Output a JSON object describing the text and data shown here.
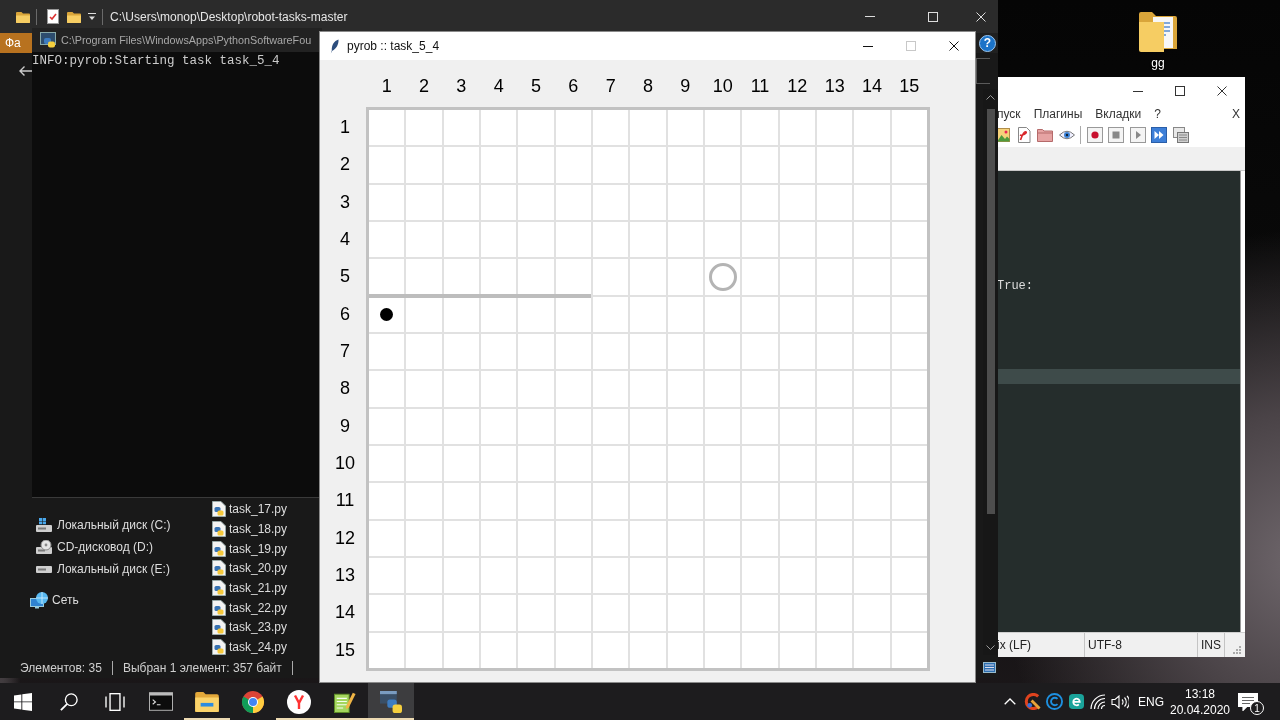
{
  "desktop_icons": [
    {
      "label": "gg"
    }
  ],
  "explorer": {
    "title": "C:\\Users\\monop\\Desktop\\robot-tasks-master",
    "ribbon_tab": "Фа",
    "help": "?",
    "nav_items": [
      {
        "kind": "system",
        "label": "Локальный диск (C:)"
      },
      {
        "kind": "optical",
        "label": "CD-дисковод (D:)"
      },
      {
        "kind": "drive",
        "label": "Локальный диск (E:)"
      },
      {
        "kind": "network",
        "label": "Сеть"
      }
    ],
    "files": [
      {
        "name": "task_17.py"
      },
      {
        "name": "task_18.py"
      },
      {
        "name": "task_19.py"
      },
      {
        "name": "task_20.py"
      },
      {
        "name": "task_21.py"
      },
      {
        "name": "task_22.py"
      },
      {
        "name": "task_23.py"
      },
      {
        "name": "task_24.py"
      }
    ],
    "status": [
      "Элементов: 35",
      "Выбран 1 элемент: 357 байт"
    ]
  },
  "console": {
    "title": "C:\\Program Files\\WindowsApps\\PythonSoftwareFou",
    "lines": [
      "INFO:pyrob:Starting task task_5_4"
    ]
  },
  "pyrob": {
    "title": "pyrob :: task_5_4",
    "controls": [
      {
        "kind": "minimize",
        "disabled": false
      },
      {
        "kind": "maximize",
        "disabled": true
      },
      {
        "kind": "close",
        "disabled": false
      }
    ],
    "columns": [
      "1",
      "2",
      "3",
      "4",
      "5",
      "6",
      "7",
      "8",
      "9",
      "10",
      "11",
      "12",
      "13",
      "14",
      "15"
    ],
    "rows": [
      {
        "label": "1",
        "cells": [
          {
            "kind": "floor"
          },
          {
            "kind": "floor"
          },
          {
            "kind": "floor"
          },
          {
            "kind": "floor"
          },
          {
            "kind": "floor"
          },
          {
            "kind": "floor"
          },
          {
            "kind": "floor"
          },
          {
            "kind": "floor"
          },
          {
            "kind": "floor"
          },
          {
            "kind": "floor"
          },
          {
            "kind": "floor"
          },
          {
            "kind": "floor"
          },
          {
            "kind": "floor"
          },
          {
            "kind": "floor"
          },
          {
            "kind": "floor"
          }
        ]
      },
      {
        "label": "2",
        "cells": [
          {
            "kind": "floor"
          },
          {
            "kind": "floor"
          },
          {
            "kind": "floor"
          },
          {
            "kind": "floor"
          },
          {
            "kind": "floor"
          },
          {
            "kind": "floor"
          },
          {
            "kind": "floor"
          },
          {
            "kind": "floor"
          },
          {
            "kind": "floor"
          },
          {
            "kind": "floor"
          },
          {
            "kind": "floor"
          },
          {
            "kind": "floor"
          },
          {
            "kind": "floor"
          },
          {
            "kind": "floor"
          },
          {
            "kind": "floor"
          }
        ]
      },
      {
        "label": "3",
        "cells": [
          {
            "kind": "floor"
          },
          {
            "kind": "floor"
          },
          {
            "kind": "floor"
          },
          {
            "kind": "floor"
          },
          {
            "kind": "floor"
          },
          {
            "kind": "floor"
          },
          {
            "kind": "floor"
          },
          {
            "kind": "floor"
          },
          {
            "kind": "floor"
          },
          {
            "kind": "floor"
          },
          {
            "kind": "floor"
          },
          {
            "kind": "floor"
          },
          {
            "kind": "floor"
          },
          {
            "kind": "floor"
          },
          {
            "kind": "floor"
          }
        ]
      },
      {
        "label": "4",
        "cells": [
          {
            "kind": "floor"
          },
          {
            "kind": "floor"
          },
          {
            "kind": "floor"
          },
          {
            "kind": "floor"
          },
          {
            "kind": "floor"
          },
          {
            "kind": "floor"
          },
          {
            "kind": "floor"
          },
          {
            "kind": "floor"
          },
          {
            "kind": "floor"
          },
          {
            "kind": "floor"
          },
          {
            "kind": "floor"
          },
          {
            "kind": "floor"
          },
          {
            "kind": "floor"
          },
          {
            "kind": "floor"
          },
          {
            "kind": "floor"
          }
        ]
      },
      {
        "label": "5",
        "cells": [
          {
            "kind": "wall"
          },
          {
            "kind": "wall"
          },
          {
            "kind": "wall"
          },
          {
            "kind": "wall"
          },
          {
            "kind": "wall"
          },
          {
            "kind": "wall"
          },
          {
            "kind": "floor"
          },
          {
            "kind": "floor"
          },
          {
            "kind": "floor"
          },
          {
            "kind": "target"
          },
          {
            "kind": "floor"
          },
          {
            "kind": "floor"
          },
          {
            "kind": "floor"
          },
          {
            "kind": "floor"
          },
          {
            "kind": "floor"
          }
        ]
      },
      {
        "label": "6",
        "cells": [
          {
            "kind": "robot"
          },
          {
            "kind": "floor"
          },
          {
            "kind": "floor"
          },
          {
            "kind": "floor"
          },
          {
            "kind": "floor"
          },
          {
            "kind": "floor"
          },
          {
            "kind": "floor"
          },
          {
            "kind": "floor"
          },
          {
            "kind": "floor"
          },
          {
            "kind": "floor"
          },
          {
            "kind": "floor"
          },
          {
            "kind": "floor"
          },
          {
            "kind": "floor"
          },
          {
            "kind": "floor"
          },
          {
            "kind": "floor"
          }
        ]
      },
      {
        "label": "7",
        "cells": [
          {
            "kind": "floor"
          },
          {
            "kind": "floor"
          },
          {
            "kind": "floor"
          },
          {
            "kind": "floor"
          },
          {
            "kind": "floor"
          },
          {
            "kind": "floor"
          },
          {
            "kind": "floor"
          },
          {
            "kind": "floor"
          },
          {
            "kind": "floor"
          },
          {
            "kind": "floor"
          },
          {
            "kind": "floor"
          },
          {
            "kind": "floor"
          },
          {
            "kind": "floor"
          },
          {
            "kind": "floor"
          },
          {
            "kind": "floor"
          }
        ]
      },
      {
        "label": "8",
        "cells": [
          {
            "kind": "floor"
          },
          {
            "kind": "floor"
          },
          {
            "kind": "floor"
          },
          {
            "kind": "floor"
          },
          {
            "kind": "floor"
          },
          {
            "kind": "floor"
          },
          {
            "kind": "floor"
          },
          {
            "kind": "floor"
          },
          {
            "kind": "floor"
          },
          {
            "kind": "floor"
          },
          {
            "kind": "floor"
          },
          {
            "kind": "floor"
          },
          {
            "kind": "floor"
          },
          {
            "kind": "floor"
          },
          {
            "kind": "floor"
          }
        ]
      },
      {
        "label": "9",
        "cells": [
          {
            "kind": "floor"
          },
          {
            "kind": "floor"
          },
          {
            "kind": "floor"
          },
          {
            "kind": "floor"
          },
          {
            "kind": "floor"
          },
          {
            "kind": "floor"
          },
          {
            "kind": "floor"
          },
          {
            "kind": "floor"
          },
          {
            "kind": "floor"
          },
          {
            "kind": "floor"
          },
          {
            "kind": "floor"
          },
          {
            "kind": "floor"
          },
          {
            "kind": "floor"
          },
          {
            "kind": "floor"
          },
          {
            "kind": "floor"
          }
        ]
      },
      {
        "label": "10",
        "cells": [
          {
            "kind": "floor"
          },
          {
            "kind": "floor"
          },
          {
            "kind": "floor"
          },
          {
            "kind": "floor"
          },
          {
            "kind": "floor"
          },
          {
            "kind": "floor"
          },
          {
            "kind": "floor"
          },
          {
            "kind": "floor"
          },
          {
            "kind": "floor"
          },
          {
            "kind": "floor"
          },
          {
            "kind": "floor"
          },
          {
            "kind": "floor"
          },
          {
            "kind": "floor"
          },
          {
            "kind": "floor"
          },
          {
            "kind": "floor"
          }
        ]
      },
      {
        "label": "11",
        "cells": [
          {
            "kind": "floor"
          },
          {
            "kind": "floor"
          },
          {
            "kind": "floor"
          },
          {
            "kind": "floor"
          },
          {
            "kind": "floor"
          },
          {
            "kind": "floor"
          },
          {
            "kind": "floor"
          },
          {
            "kind": "floor"
          },
          {
            "kind": "floor"
          },
          {
            "kind": "floor"
          },
          {
            "kind": "floor"
          },
          {
            "kind": "floor"
          },
          {
            "kind": "floor"
          },
          {
            "kind": "floor"
          },
          {
            "kind": "floor"
          }
        ]
      },
      {
        "label": "12",
        "cells": [
          {
            "kind": "floor"
          },
          {
            "kind": "floor"
          },
          {
            "kind": "floor"
          },
          {
            "kind": "floor"
          },
          {
            "kind": "floor"
          },
          {
            "kind": "floor"
          },
          {
            "kind": "floor"
          },
          {
            "kind": "floor"
          },
          {
            "kind": "floor"
          },
          {
            "kind": "floor"
          },
          {
            "kind": "floor"
          },
          {
            "kind": "floor"
          },
          {
            "kind": "floor"
          },
          {
            "kind": "floor"
          },
          {
            "kind": "floor"
          }
        ]
      },
      {
        "label": "13",
        "cells": [
          {
            "kind": "floor"
          },
          {
            "kind": "floor"
          },
          {
            "kind": "floor"
          },
          {
            "kind": "floor"
          },
          {
            "kind": "floor"
          },
          {
            "kind": "floor"
          },
          {
            "kind": "floor"
          },
          {
            "kind": "floor"
          },
          {
            "kind": "floor"
          },
          {
            "kind": "floor"
          },
          {
            "kind": "floor"
          },
          {
            "kind": "floor"
          },
          {
            "kind": "floor"
          },
          {
            "kind": "floor"
          },
          {
            "kind": "floor"
          }
        ]
      },
      {
        "label": "14",
        "cells": [
          {
            "kind": "floor"
          },
          {
            "kind": "floor"
          },
          {
            "kind": "floor"
          },
          {
            "kind": "floor"
          },
          {
            "kind": "floor"
          },
          {
            "kind": "floor"
          },
          {
            "kind": "floor"
          },
          {
            "kind": "floor"
          },
          {
            "kind": "floor"
          },
          {
            "kind": "floor"
          },
          {
            "kind": "floor"
          },
          {
            "kind": "floor"
          },
          {
            "kind": "floor"
          },
          {
            "kind": "floor"
          },
          {
            "kind": "floor"
          }
        ]
      },
      {
        "label": "15",
        "cells": [
          {
            "kind": "floor"
          },
          {
            "kind": "floor"
          },
          {
            "kind": "floor"
          },
          {
            "kind": "floor"
          },
          {
            "kind": "floor"
          },
          {
            "kind": "floor"
          },
          {
            "kind": "floor"
          },
          {
            "kind": "floor"
          },
          {
            "kind": "floor"
          },
          {
            "kind": "floor"
          },
          {
            "kind": "floor"
          },
          {
            "kind": "floor"
          },
          {
            "kind": "floor"
          },
          {
            "kind": "floor"
          },
          {
            "kind": "floor"
          }
        ]
      }
    ]
  },
  "notepad": {
    "menu": [
      "пуск",
      "Плагины",
      "Вкладки",
      "?"
    ],
    "close_document": "X",
    "toolbar": [
      {
        "kind": "picture"
      },
      {
        "kind": "document"
      },
      {
        "kind": "folder"
      },
      {
        "kind": "eye"
      },
      {
        "kind": "separator"
      },
      {
        "kind": "record"
      },
      {
        "kind": "stop"
      },
      {
        "kind": "play"
      },
      {
        "kind": "fastforward"
      },
      {
        "kind": "macros"
      }
    ],
    "lines": [
      {
        "current": false
      },
      {
        "current": false
      },
      {
        "current": false
      },
      {
        "current": false
      },
      {
        "current": false
      },
      {
        "current": false
      },
      {
        "current": false
      },
      {
        "text": "True:",
        "current": false
      },
      {
        "current": false
      },
      {
        "current": false
      },
      {
        "current": false
      },
      {
        "current": false
      },
      {
        "current": false
      },
      {
        "current": true
      }
    ],
    "status": [
      "ix (LF)",
      "UTF-8",
      "INS"
    ]
  },
  "taskbar": {
    "buttons": [
      {
        "kind": "start"
      },
      {
        "kind": "search"
      },
      {
        "kind": "taskview"
      }
    ],
    "apps": [
      {
        "kind": "terminal",
        "running": false,
        "selected": false
      },
      {
        "kind": "explorer",
        "running": true,
        "selected": false
      },
      {
        "kind": "chrome",
        "running": false,
        "selected": false
      },
      {
        "kind": "yandex",
        "running": true,
        "selected": false
      },
      {
        "kind": "notepad",
        "running": true,
        "selected": false
      },
      {
        "kind": "python",
        "running": true,
        "selected": true
      }
    ],
    "tray": [
      {
        "kind": "chevron"
      },
      {
        "kind": "cleaner"
      },
      {
        "kind": "circle"
      },
      {
        "kind": "badge"
      },
      {
        "kind": "wifi"
      },
      {
        "kind": "volume"
      }
    ],
    "language": "ENG",
    "time": "13:18",
    "date": "20.04.2020",
    "notifications": "1"
  }
}
